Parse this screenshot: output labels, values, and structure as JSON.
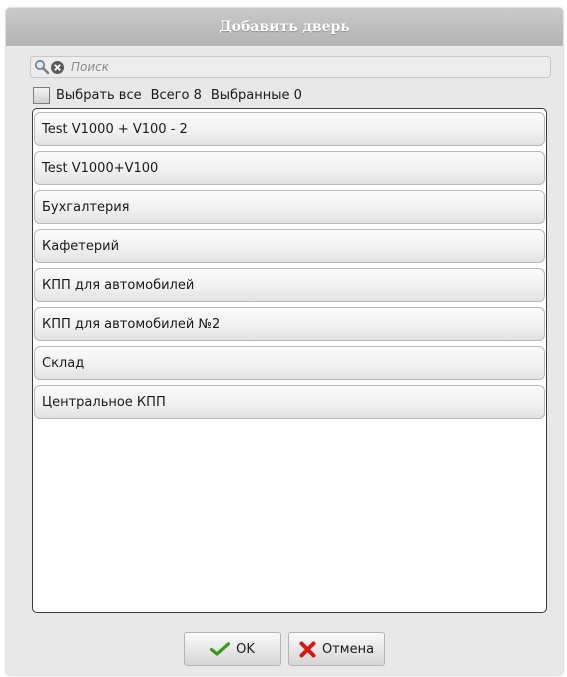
{
  "dialog": {
    "title": "Добавить дверь"
  },
  "search": {
    "placeholder": "Поиск",
    "value": ""
  },
  "selection": {
    "select_all_label": "Выбрать все",
    "total_text": "Всего 8",
    "selected_text": "Выбранные 0",
    "select_all_checked": false
  },
  "doors": [
    {
      "label": "Test V1000 + V100 - 2"
    },
    {
      "label": "Test V1000+V100"
    },
    {
      "label": "Бухгалтерия"
    },
    {
      "label": "Кафетерий"
    },
    {
      "label": "КПП для автомобилей"
    },
    {
      "label": "КПП для автомобилей №2"
    },
    {
      "label": "Склад"
    },
    {
      "label": "Центральное КПП"
    }
  ],
  "footer": {
    "ok_label": "OK",
    "cancel_label": "Отмена"
  },
  "icons": {
    "search": "search-icon",
    "clear": "clear-icon",
    "ok": "checkmark-icon",
    "cancel": "red-x-icon"
  },
  "colors": {
    "ok_check": "#3a9a1c",
    "cancel_x": "#d6180f"
  }
}
